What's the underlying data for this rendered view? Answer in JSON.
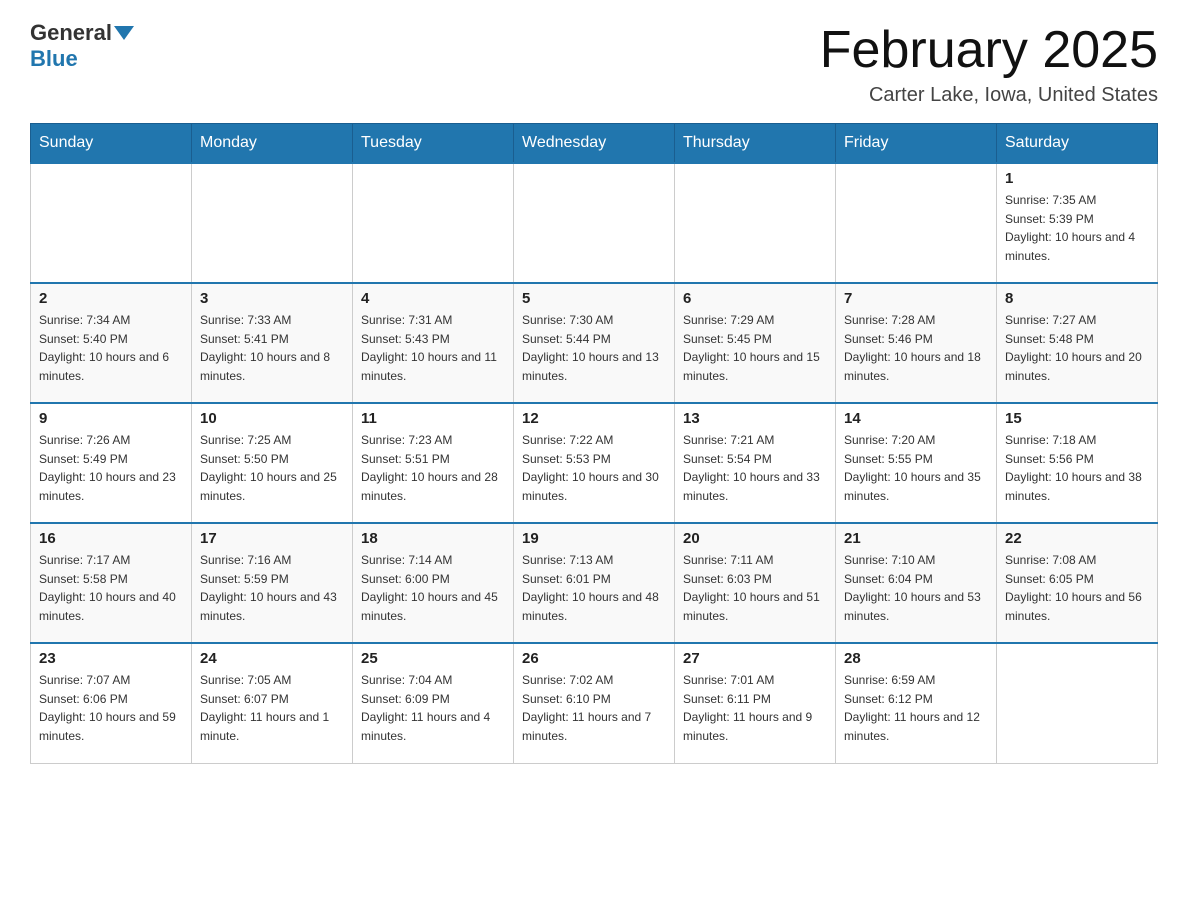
{
  "header": {
    "logo_general": "General",
    "logo_blue": "Blue",
    "title": "February 2025",
    "subtitle": "Carter Lake, Iowa, United States"
  },
  "days_of_week": [
    "Sunday",
    "Monday",
    "Tuesday",
    "Wednesday",
    "Thursday",
    "Friday",
    "Saturday"
  ],
  "weeks": [
    [
      {
        "day": "",
        "info": ""
      },
      {
        "day": "",
        "info": ""
      },
      {
        "day": "",
        "info": ""
      },
      {
        "day": "",
        "info": ""
      },
      {
        "day": "",
        "info": ""
      },
      {
        "day": "",
        "info": ""
      },
      {
        "day": "1",
        "info": "Sunrise: 7:35 AM\nSunset: 5:39 PM\nDaylight: 10 hours and 4 minutes."
      }
    ],
    [
      {
        "day": "2",
        "info": "Sunrise: 7:34 AM\nSunset: 5:40 PM\nDaylight: 10 hours and 6 minutes."
      },
      {
        "day": "3",
        "info": "Sunrise: 7:33 AM\nSunset: 5:41 PM\nDaylight: 10 hours and 8 minutes."
      },
      {
        "day": "4",
        "info": "Sunrise: 7:31 AM\nSunset: 5:43 PM\nDaylight: 10 hours and 11 minutes."
      },
      {
        "day": "5",
        "info": "Sunrise: 7:30 AM\nSunset: 5:44 PM\nDaylight: 10 hours and 13 minutes."
      },
      {
        "day": "6",
        "info": "Sunrise: 7:29 AM\nSunset: 5:45 PM\nDaylight: 10 hours and 15 minutes."
      },
      {
        "day": "7",
        "info": "Sunrise: 7:28 AM\nSunset: 5:46 PM\nDaylight: 10 hours and 18 minutes."
      },
      {
        "day": "8",
        "info": "Sunrise: 7:27 AM\nSunset: 5:48 PM\nDaylight: 10 hours and 20 minutes."
      }
    ],
    [
      {
        "day": "9",
        "info": "Sunrise: 7:26 AM\nSunset: 5:49 PM\nDaylight: 10 hours and 23 minutes."
      },
      {
        "day": "10",
        "info": "Sunrise: 7:25 AM\nSunset: 5:50 PM\nDaylight: 10 hours and 25 minutes."
      },
      {
        "day": "11",
        "info": "Sunrise: 7:23 AM\nSunset: 5:51 PM\nDaylight: 10 hours and 28 minutes."
      },
      {
        "day": "12",
        "info": "Sunrise: 7:22 AM\nSunset: 5:53 PM\nDaylight: 10 hours and 30 minutes."
      },
      {
        "day": "13",
        "info": "Sunrise: 7:21 AM\nSunset: 5:54 PM\nDaylight: 10 hours and 33 minutes."
      },
      {
        "day": "14",
        "info": "Sunrise: 7:20 AM\nSunset: 5:55 PM\nDaylight: 10 hours and 35 minutes."
      },
      {
        "day": "15",
        "info": "Sunrise: 7:18 AM\nSunset: 5:56 PM\nDaylight: 10 hours and 38 minutes."
      }
    ],
    [
      {
        "day": "16",
        "info": "Sunrise: 7:17 AM\nSunset: 5:58 PM\nDaylight: 10 hours and 40 minutes."
      },
      {
        "day": "17",
        "info": "Sunrise: 7:16 AM\nSunset: 5:59 PM\nDaylight: 10 hours and 43 minutes."
      },
      {
        "day": "18",
        "info": "Sunrise: 7:14 AM\nSunset: 6:00 PM\nDaylight: 10 hours and 45 minutes."
      },
      {
        "day": "19",
        "info": "Sunrise: 7:13 AM\nSunset: 6:01 PM\nDaylight: 10 hours and 48 minutes."
      },
      {
        "day": "20",
        "info": "Sunrise: 7:11 AM\nSunset: 6:03 PM\nDaylight: 10 hours and 51 minutes."
      },
      {
        "day": "21",
        "info": "Sunrise: 7:10 AM\nSunset: 6:04 PM\nDaylight: 10 hours and 53 minutes."
      },
      {
        "day": "22",
        "info": "Sunrise: 7:08 AM\nSunset: 6:05 PM\nDaylight: 10 hours and 56 minutes."
      }
    ],
    [
      {
        "day": "23",
        "info": "Sunrise: 7:07 AM\nSunset: 6:06 PM\nDaylight: 10 hours and 59 minutes."
      },
      {
        "day": "24",
        "info": "Sunrise: 7:05 AM\nSunset: 6:07 PM\nDaylight: 11 hours and 1 minute."
      },
      {
        "day": "25",
        "info": "Sunrise: 7:04 AM\nSunset: 6:09 PM\nDaylight: 11 hours and 4 minutes."
      },
      {
        "day": "26",
        "info": "Sunrise: 7:02 AM\nSunset: 6:10 PM\nDaylight: 11 hours and 7 minutes."
      },
      {
        "day": "27",
        "info": "Sunrise: 7:01 AM\nSunset: 6:11 PM\nDaylight: 11 hours and 9 minutes."
      },
      {
        "day": "28",
        "info": "Sunrise: 6:59 AM\nSunset: 6:12 PM\nDaylight: 11 hours and 12 minutes."
      },
      {
        "day": "",
        "info": ""
      }
    ]
  ],
  "colors": {
    "header_bg": "#2176ae",
    "header_text": "#ffffff",
    "border": "#aaaaaa",
    "day_number": "#222222",
    "day_info": "#333333"
  }
}
